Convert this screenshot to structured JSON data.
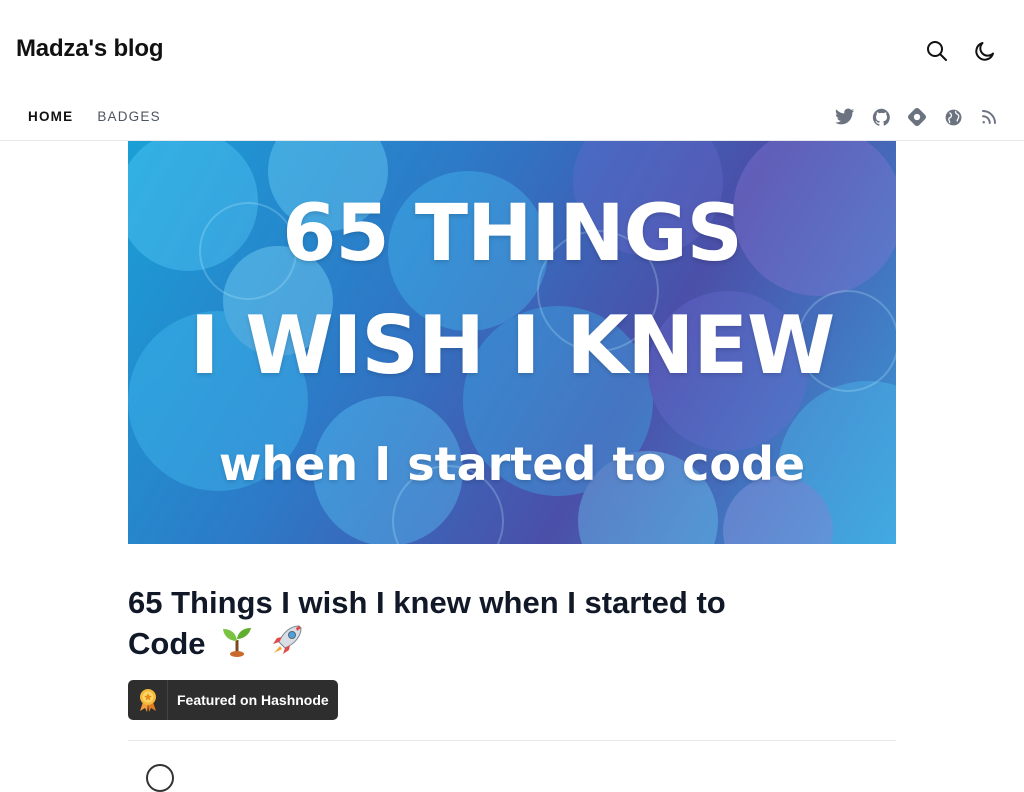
{
  "header": {
    "blog_title": "Madza's blog"
  },
  "nav": {
    "items": [
      {
        "label": "HOME",
        "active": true
      },
      {
        "label": "BADGES",
        "active": false
      }
    ]
  },
  "social_icons": [
    "twitter-icon",
    "github-icon",
    "hashnode-icon",
    "globe-icon",
    "rss-icon"
  ],
  "cover": {
    "line1": "65 THINGS",
    "line2": "I WISH I KNEW",
    "line3": "when I started to code"
  },
  "post": {
    "title_main": "65 Things I wish I knew when I started to",
    "title_end": "Code",
    "emojis": [
      "seedling-emoji",
      "rocket-emoji"
    ]
  },
  "badge": {
    "label": "Featured on Hashnode"
  }
}
